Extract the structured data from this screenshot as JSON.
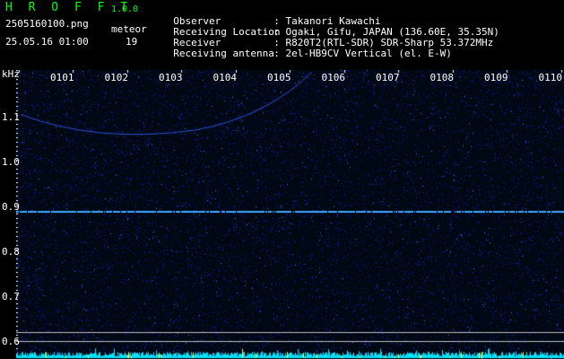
{
  "header": {
    "logo": "H R O F F T",
    "version": "1.0.0",
    "filename": "2505160100.png",
    "datetime": "25.05.16 01:00",
    "meteor_label": "meteor",
    "meteor_count": "19"
  },
  "meta": [
    {
      "key": "Observer",
      "value": ": Takanori Kawachi"
    },
    {
      "key": "Receiving Location",
      "value": ": Ogaki, Gifu, JAPAN (136.60E, 35.35N)"
    },
    {
      "key": "Receiver",
      "value": ": R820T2(RTL-SDR) SDR-Sharp 53.372MHz"
    },
    {
      "key": "Receiving antenna",
      "value": ": 2el-HB9CV Vertical (el. E-W)"
    }
  ],
  "plot": {
    "unit_label": "kHz",
    "y_labels": [
      "1.1",
      "1.0",
      "0.9",
      "0.8",
      "0.7",
      "0.6"
    ],
    "y_values": [
      1.1,
      1.0,
      0.9,
      0.8,
      0.7,
      0.6
    ],
    "ylim": [
      0.58,
      1.2
    ],
    "time_labels": [
      "0101",
      "0102",
      "0103",
      "0104",
      "0105",
      "0106",
      "0107",
      "0108",
      "0109",
      "0110"
    ],
    "carrier_khz": 0.89,
    "ref_lines_khz": [
      0.62,
      0.6
    ],
    "background_color": "#000814",
    "carrier_color": "#3fa9ff",
    "noise_color": "#1a2bd8",
    "spectrum_color": "#00e5ff"
  }
}
